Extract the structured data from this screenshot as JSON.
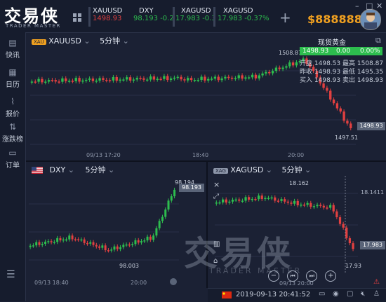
{
  "app": {
    "logo_text": "交易侠",
    "logo_sub": "TRADER MASTER",
    "balance": "$888888",
    "add_label": "+",
    "window_controls": [
      "–",
      "□",
      "✕"
    ]
  },
  "tickers": [
    {
      "symbol": "XAUUSD",
      "price": "1498.93",
      "change": ""
    },
    {
      "symbol": "DXY",
      "price": "98.193",
      "change": "-0.2"
    },
    {
      "symbol": "XAGUSD",
      "price": "17.983",
      "change": "-0.3"
    },
    {
      "symbol": "XAGUSD",
      "price": "17.983",
      "change": "-0.37%"
    }
  ],
  "sidebar": {
    "items": [
      {
        "label": "快讯",
        "icon": "news-icon"
      },
      {
        "label": "日历",
        "icon": "calendar-icon"
      },
      {
        "label": "报价",
        "icon": "quote-icon"
      },
      {
        "label": "涨跌榜",
        "icon": "ranking-icon"
      },
      {
        "label": "订单",
        "icon": "order-icon"
      }
    ]
  },
  "main_chart": {
    "symbol": "XAUUSD",
    "interval": "5分钟",
    "tag": "XAU",
    "high_label": "1508.87",
    "low_label": "1497.51",
    "price_tag": "1498.93",
    "time_labels": [
      "09/13 17:20",
      "18:40",
      "20:00"
    ],
    "info": {
      "title": "现货黄金",
      "price": "1498.93",
      "change": "0.00",
      "pct": "0.00%",
      "open_label": "开盘",
      "open": "1498.53",
      "high_label": "最高",
      "high": "1508.87",
      "prev_label": "昨收",
      "prev": "1498.93",
      "low_label": "最低",
      "low": "1495.35",
      "buy_label": "买入",
      "buy": "1498.93",
      "sell_label": "卖出",
      "sell": "1498.93"
    }
  },
  "dxy_chart": {
    "symbol": "DXY",
    "interval": "5分钟",
    "high_label": "98.194",
    "low_label": "98.003",
    "price_tag": "98.193",
    "time_labels": [
      "09/13 18:40",
      "20:00"
    ]
  },
  "xag_chart": {
    "symbol": "XAGUSD",
    "interval": "5分钟",
    "tag": "XAG",
    "high_label": "18.162",
    "crosshair_label": "18.1411",
    "low_label": "17.93",
    "price_tag": "17.983",
    "time_labels": [
      "09/13 20:00"
    ]
  },
  "status": {
    "datetime": "2019-09-13 20:41:52",
    "toolbar_plus": "+",
    "toolbar_minus": "−"
  },
  "colors": {
    "up": "#2dbd4e",
    "down": "#e24040",
    "accent": "#f0a020",
    "bg": "#1b2134"
  }
}
